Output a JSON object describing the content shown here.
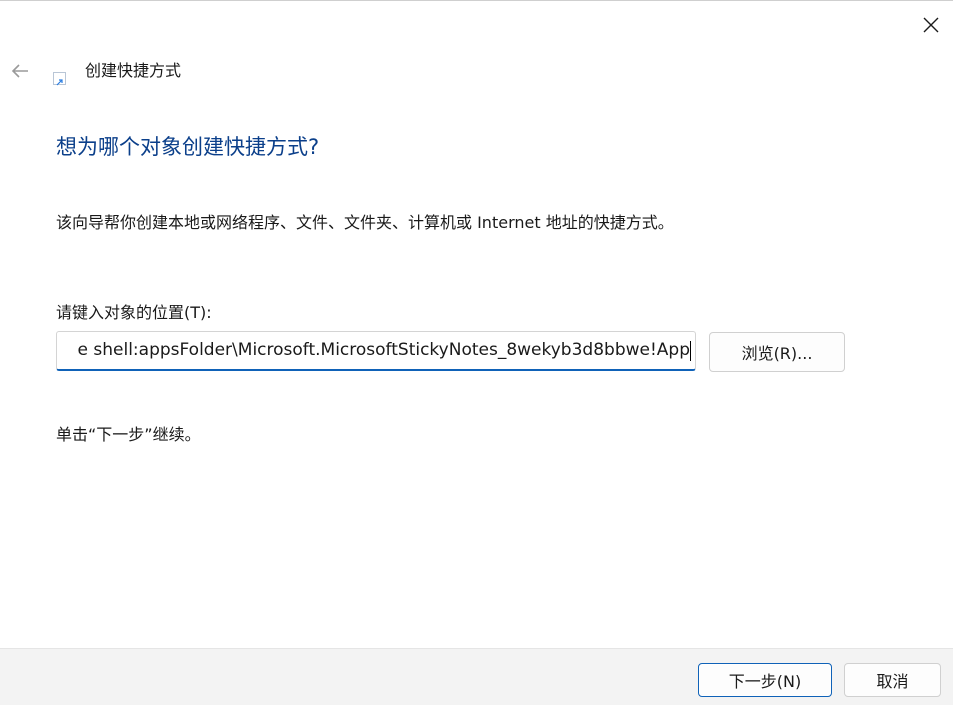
{
  "window": {
    "title": "创建快捷方式"
  },
  "icons": {
    "close": "close-icon",
    "back": "back-arrow-icon",
    "wizard": "shortcut-icon"
  },
  "page": {
    "heading": "想为哪个对象创建快捷方式?",
    "description": "该向导帮你创建本地或网络程序、文件、文件夹、计算机或 Internet 地址的快捷方式。",
    "location_label": "请键入对象的位置(T):",
    "location_value": "e shell:appsFolder\\Microsoft.MicrosoftStickyNotes_8wekyb3d8bbwe!App",
    "browse_label": "浏览(R)...",
    "continue_hint": "单击“下一步”继续。"
  },
  "footer": {
    "next_label": "下一步(N)",
    "cancel_label": "取消"
  },
  "colors": {
    "heading": "#0b3f8a",
    "accent": "#0f62b8",
    "footer_bg": "#f3f3f3"
  }
}
